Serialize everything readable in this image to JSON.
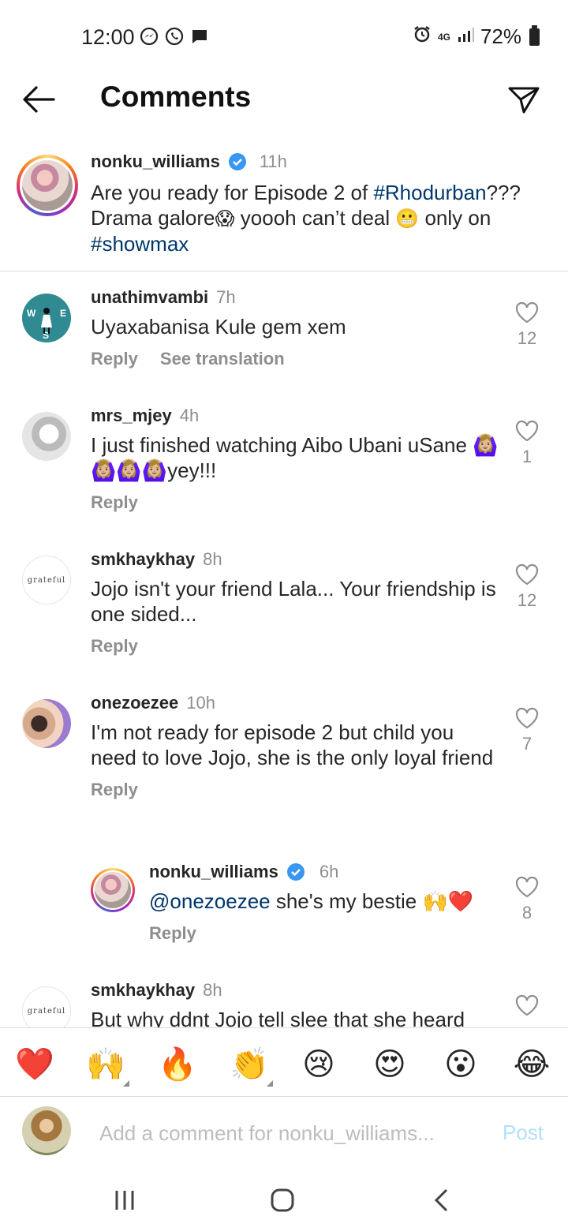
{
  "status_bar": {
    "time": "12:00",
    "battery": "72%",
    "network": "4G"
  },
  "header": {
    "title": "Comments"
  },
  "caption": {
    "username": "nonku_williams",
    "time": "11h",
    "text_parts": [
      {
        "t": "Are you ready for Episode 2 of ",
        "kind": "text"
      },
      {
        "t": "#Rhodurban",
        "kind": "tag"
      },
      {
        "t": "??? Drama galore",
        "kind": "text"
      },
      {
        "t": "😱",
        "kind": "emoji"
      },
      {
        "t": " yoooh can’t deal ",
        "kind": "text"
      },
      {
        "t": "😬",
        "kind": "emoji"
      },
      {
        "t": " only on ",
        "kind": "text"
      },
      {
        "t": "#showmax",
        "kind": "tag"
      }
    ]
  },
  "comments": [
    {
      "username": "unathimvambi",
      "time": "7h",
      "text": "Uyaxabanisa Kule gem xem",
      "likes": "12",
      "reply": "Reply",
      "translate": "See translation",
      "avatar": "wes"
    },
    {
      "username": "mrs_mjey",
      "time": "4h",
      "text": "I just finished watching Aibo Ubani uSane 🙆🏼‍♀️🙆🏼‍♀️🙆🏼‍♀️🙆🏼‍♀️yey!!!",
      "likes": "1",
      "reply": "Reply",
      "avatar": "mjey"
    },
    {
      "username": "smkhaykhay",
      "time": "8h",
      "text": "Jojo isn't your friend Lala... Your friendship is one sided...",
      "likes": "12",
      "reply": "Reply",
      "avatar": "grateful"
    },
    {
      "username": "onezoezee",
      "time": "10h",
      "text": "I'm not ready for episode 2 but child you need to love Jojo, she is the only loyal friend",
      "likes": "7",
      "reply": "Reply",
      "avatar": "zoe"
    },
    {
      "username": "nonku_williams",
      "time": "6h",
      "mention": "@onezoezee",
      "text": " she's my bestie 🙌❤️",
      "likes": "8",
      "reply": "Reply",
      "avatar": "nonku"
    },
    {
      "username": "smkhaykhay",
      "time": "8h",
      "text": "But why ddnt Jojo tell slee that she heard",
      "avatar": "grateful"
    }
  ],
  "avatar_text": {
    "grateful": "grateful",
    "w": "W",
    "e": "E",
    "s": "S"
  },
  "emoji_bar": [
    "❤️",
    "🙌",
    "🔥",
    "👏",
    "😢",
    "😍",
    "😮",
    "😂"
  ],
  "input": {
    "placeholder": "Add a comment for nonku_williams...",
    "post_label": "Post"
  },
  "colors": {
    "hashtag": "#00376b",
    "verified": "#3897f0",
    "post_disabled": "#b2dffc",
    "meta": "#8e8e8e"
  }
}
